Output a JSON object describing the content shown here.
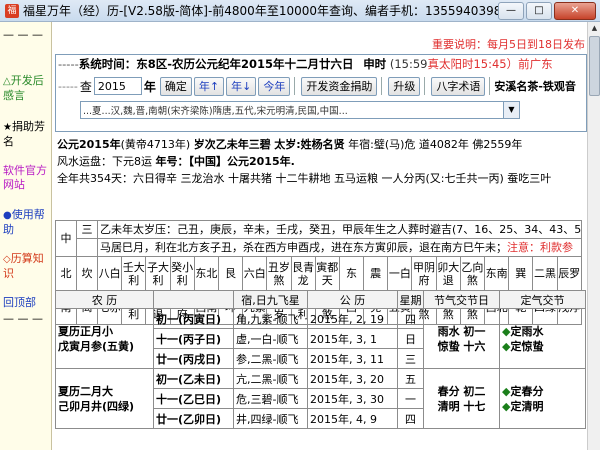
{
  "window": {
    "title": "福星万年（经）历-[V2.58版-简体]-前4800年至10000年查询、编者手机：13559403980、...",
    "icon": "福",
    "minimize": "—",
    "maximize": "□",
    "close": "✕"
  },
  "sidebar": {
    "items": [
      {
        "bullet": "— — —",
        "label": ""
      },
      {
        "bullet": "△",
        "label": "开发后感言",
        "color": "#2a8a2a"
      },
      {
        "bullet": "★",
        "label": "捐助芳名",
        "color": "#000000"
      },
      {
        "bullet": "",
        "label": "软件官方网站",
        "color": "#b81ac4"
      },
      {
        "bullet": "●",
        "label": "使用帮助",
        "color": "#1e3fbf"
      },
      {
        "bullet": "◇",
        "label": "历算知识",
        "color": "#d33a1a"
      },
      {
        "bullet": "",
        "label": "回顶部",
        "color": "#1e3fbf"
      },
      {
        "bullet": "— — —",
        "label": ""
      }
    ]
  },
  "notice": {
    "label": "重要说明：",
    "text": "每月5日到18日发布"
  },
  "system": {
    "lead": "-----",
    "label": "系统时间：",
    "value": "东8区-农历公元纪年2015年十二月廿六日",
    "shichen": "申时",
    "clock": "(15:59",
    "solar": "真太阳时15:45）",
    "zone": "前广东"
  },
  "controls": {
    "lead": "-----",
    "query_label": "查",
    "year_value": "2015",
    "year_label": "年",
    "confirm": "确定",
    "prev_year": "年↑",
    "next_year": "年↓",
    "this_year": "今年",
    "donate": "开发资金捐助",
    "upgrade": "升级",
    "bazi": "八字术语",
    "ad": "安溪名茶-铁观音"
  },
  "dynasty": {
    "text": "...夏...汉,魏,晋,南朝(宋齐梁陈)隋唐,五代,宋元明清,民国,中国..."
  },
  "info": {
    "line1_a": "公元2015年",
    "line1_b": "(黄帝4713年)",
    "line1_c": "岁次乙未年三碧",
    "line1_d": "太岁:姓杨名贤",
    "line1_e": "年宿:璧(马)危",
    "line1_f": "道4082年",
    "line1_g": "佛2559年",
    "line2_a": "风水运盘：下元8运",
    "line2_b": "年号：【中国】公元2015年.",
    "line3": "全年共354天：六日得辛  三龙治水  十屠共猪  十二牛耕地  五马运粮  一人分丙(又:七壬共一丙)  蚕吃三叶"
  },
  "grid": {
    "rows": [
      [
        "中",
        "三",
        "乙未年太岁压：己丑，庚辰，辛未，壬戌，癸丑，甲辰年生之人葬时避吉(7、16、25、34、43、52、67"
      ],
      [
        "",
        "",
        "马居巳月，利在北方亥子丑，杀在西方申酉戌，进在东方寅卯辰，退在南方巳午未；",
        "注意：利款参"
      ],
      [
        "北",
        "坎",
        "八白",
        "壬大利",
        "子大利",
        "癸小利",
        "东北",
        "艮",
        "六白",
        "丑岁煞",
        "艮青龙",
        "寅都天",
        "东",
        "震",
        "一白",
        "甲阴府",
        "卯大退",
        "乙向煞",
        "东南",
        "巽",
        "二黑",
        "辰罗"
      ],
      [
        "南",
        "离",
        "七赤",
        "丙小利",
        "午炙退",
        "丁阴府",
        "西南",
        "坤",
        "九紫",
        "未太岁",
        "坤小利",
        "申三煞",
        "西",
        "兑",
        "五黄",
        "庚三煞",
        "酉三煞",
        "辛三煞",
        "西北",
        "乾",
        "四绿",
        "戌浮"
      ]
    ]
  },
  "table": {
    "headers": [
      "农 历",
      "",
      "宿,日九飞星",
      "公 历",
      "星期",
      "节气交节日",
      "定气交节"
    ],
    "months": [
      {
        "name": "夏历正月小",
        "ganzhi": "戊寅月参(五黄)",
        "days": [
          {
            "day": "初一(丙寅日)",
            "star": "角,九紫-顺飞",
            "date": "2015年, 2, 19",
            "week": "四",
            "jq": "雨水  初一",
            "dq": "◆定雨水"
          },
          {
            "day": "十一(丙子日)",
            "star": "虚,一白-顺飞",
            "date": "2015年, 3, 1",
            "week": "日",
            "jq": "惊蛰  十六",
            "dq": "◆定惊蛰"
          },
          {
            "day": "廿一(丙戌日)",
            "star": "参,二黑-顺飞",
            "date": "2015年, 3, 11",
            "week": "三",
            "jq": "",
            "dq": ""
          }
        ]
      },
      {
        "name": "夏历二月大",
        "ganzhi": "己卯月井(四绿)",
        "days": [
          {
            "day": "初一(乙未日)",
            "star": "亢,二黑-顺飞",
            "date": "2015年, 3, 20",
            "week": "五",
            "jq": "春分  初二",
            "dq": "◆定春分"
          },
          {
            "day": "十一(乙巳日)",
            "star": "危,三碧-顺飞",
            "date": "2015年, 3, 30",
            "week": "一",
            "jq": "清明  十七",
            "dq": "◆定清明"
          },
          {
            "day": "廿一(乙卯日)",
            "star": "井,四绿-顺飞",
            "date": "2015年, 4, 9",
            "week": "四",
            "jq": "",
            "dq": ""
          }
        ]
      }
    ]
  }
}
